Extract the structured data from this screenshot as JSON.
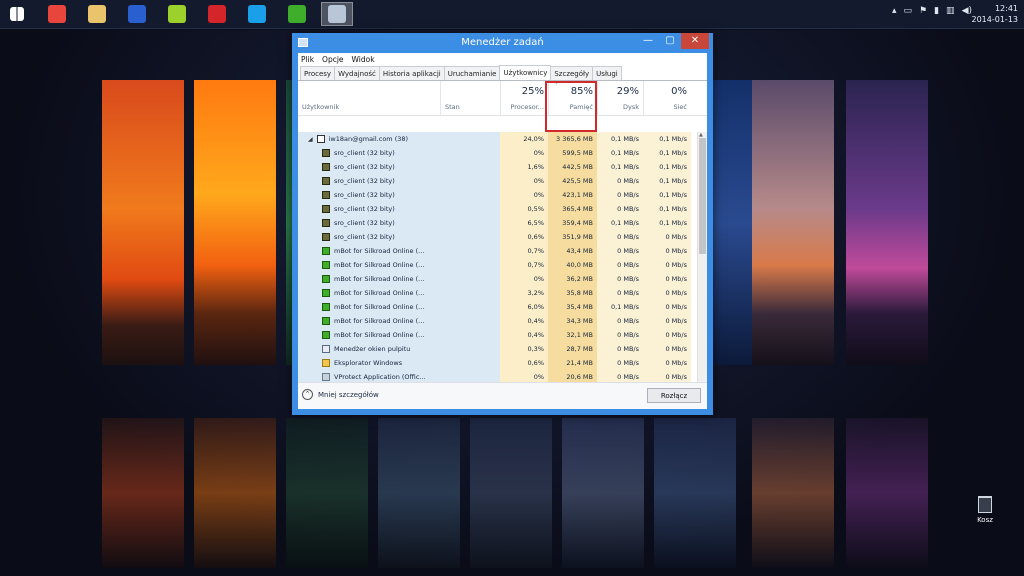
{
  "taskbar": {
    "apps": [
      {
        "name": "start-button",
        "icon": "windows-logo-icon",
        "color": "#ffffff",
        "active": false
      },
      {
        "name": "chrome",
        "icon": "chrome-icon",
        "color": "#e8453c",
        "active": false
      },
      {
        "name": "file-explorer",
        "icon": "folder-icon",
        "color": "#e9c46a",
        "active": false
      },
      {
        "name": "silkroad",
        "icon": "crown-icon",
        "color": "#2a5fd0",
        "active": false
      },
      {
        "name": "app-green-yellow",
        "icon": "battery-icon",
        "color": "#9bd12a",
        "active": false
      },
      {
        "name": "flash",
        "icon": "flash-icon",
        "color": "#d4262a",
        "active": false
      },
      {
        "name": "skype",
        "icon": "skype-icon",
        "color": "#1aa0e8",
        "active": false
      },
      {
        "name": "mbot",
        "icon": "mbot-icon",
        "color": "#3fae2a",
        "active": false
      },
      {
        "name": "task-manager",
        "icon": "task-manager-icon",
        "color": "#b8c6d8",
        "active": true
      }
    ],
    "clock": {
      "time": "12:41",
      "date": "2014-01-13"
    }
  },
  "desktop": {
    "recycle_bin_label": "Kosz"
  },
  "window": {
    "title": "Menedżer zadań",
    "menu": [
      "Plik",
      "Opcje",
      "Widok"
    ],
    "tabs": [
      "Procesy",
      "Wydajność",
      "Historia aplikacji",
      "Uruchamianie",
      "Użytkownicy",
      "Szczegóły",
      "Usługi"
    ],
    "selected_tab": "Użytkownicy",
    "columns": {
      "user": "Użytkownik",
      "status": "Stan",
      "cpu": {
        "percent": "25%",
        "label": "Procesor..."
      },
      "memory": {
        "percent": "85%",
        "label": "Pamięć"
      },
      "disk": {
        "percent": "29%",
        "label": "Dysk"
      },
      "network": {
        "percent": "0%",
        "label": "Sieć"
      }
    },
    "rows": [
      {
        "name": "iw18an@gmail.com (38)",
        "icon": "user-icon",
        "kind": "user",
        "cpu": "24,0%",
        "mem": "3 365,6 MB",
        "disk": "0,1 MB/s",
        "net": "0,1 Mb/s"
      },
      {
        "name": "sro_client (32 bity)",
        "icon": "sro-icon",
        "kind": "proc",
        "cpu": "0%",
        "mem": "599,5 MB",
        "disk": "0,1 MB/s",
        "net": "0,1 Mb/s"
      },
      {
        "name": "sro_client (32 bity)",
        "icon": "sro-icon",
        "kind": "proc",
        "cpu": "1,6%",
        "mem": "442,5 MB",
        "disk": "0,1 MB/s",
        "net": "0,1 Mb/s"
      },
      {
        "name": "sro_client (32 bity)",
        "icon": "sro-icon",
        "kind": "proc",
        "cpu": "0%",
        "mem": "425,5 MB",
        "disk": "0 MB/s",
        "net": "0,1 Mb/s"
      },
      {
        "name": "sro_client (32 bity)",
        "icon": "sro-icon",
        "kind": "proc",
        "cpu": "0%",
        "mem": "423,1 MB",
        "disk": "0 MB/s",
        "net": "0,1 Mb/s"
      },
      {
        "name": "sro_client (32 bity)",
        "icon": "sro-icon",
        "kind": "proc",
        "cpu": "0,5%",
        "mem": "365,4 MB",
        "disk": "0 MB/s",
        "net": "0,1 Mb/s"
      },
      {
        "name": "sro_client (32 bity)",
        "icon": "sro-icon",
        "kind": "proc",
        "cpu": "6,5%",
        "mem": "359,4 MB",
        "disk": "0,1 MB/s",
        "net": "0,1 Mb/s"
      },
      {
        "name": "sro_client (32 bity)",
        "icon": "sro-icon",
        "kind": "proc",
        "cpu": "0,6%",
        "mem": "351,9 MB",
        "disk": "0 MB/s",
        "net": "0 Mb/s"
      },
      {
        "name": "mBot for Silkroad Online (...",
        "icon": "mbot-icon",
        "kind": "proc",
        "cpu": "0,7%",
        "mem": "43,4 MB",
        "disk": "0 MB/s",
        "net": "0 Mb/s"
      },
      {
        "name": "mBot for Silkroad Online (...",
        "icon": "mbot-icon",
        "kind": "proc",
        "cpu": "0,7%",
        "mem": "40,0 MB",
        "disk": "0 MB/s",
        "net": "0 Mb/s"
      },
      {
        "name": "mBot for Silkroad Online (...",
        "icon": "mbot-icon",
        "kind": "proc",
        "cpu": "0%",
        "mem": "36,2 MB",
        "disk": "0 MB/s",
        "net": "0 Mb/s"
      },
      {
        "name": "mBot for Silkroad Online (...",
        "icon": "mbot-icon",
        "kind": "proc",
        "cpu": "3,2%",
        "mem": "35,8 MB",
        "disk": "0 MB/s",
        "net": "0 Mb/s"
      },
      {
        "name": "mBot for Silkroad Online (...",
        "icon": "mbot-icon",
        "kind": "proc",
        "cpu": "6,0%",
        "mem": "35,4 MB",
        "disk": "0,1 MB/s",
        "net": "0 Mb/s"
      },
      {
        "name": "mBot for Silkroad Online (...",
        "icon": "mbot-icon",
        "kind": "proc",
        "cpu": "0,4%",
        "mem": "34,3 MB",
        "disk": "0 MB/s",
        "net": "0 Mb/s"
      },
      {
        "name": "mBot for Silkroad Online (...",
        "icon": "mbot-icon",
        "kind": "proc",
        "cpu": "0,4%",
        "mem": "32,1 MB",
        "disk": "0 MB/s",
        "net": "0 Mb/s"
      },
      {
        "name": "Menedżer okien pulpitu",
        "icon": "dwm-icon",
        "kind": "proc",
        "cpu": "0,3%",
        "mem": "28,7 MB",
        "disk": "0 MB/s",
        "net": "0 Mb/s"
      },
      {
        "name": "Eksplorator Windows",
        "icon": "explorer-icon",
        "kind": "proc",
        "cpu": "0,6%",
        "mem": "21,4 MB",
        "disk": "0 MB/s",
        "net": "0 Mb/s"
      },
      {
        "name": "VProtect Application (Offic...",
        "icon": "vprotect-icon",
        "kind": "proc",
        "cpu": "0%",
        "mem": "20,6 MB",
        "disk": "0 MB/s",
        "net": "0 Mb/s"
      }
    ],
    "footer": {
      "less_details": "Mniej szczegółów",
      "end_task": "Rozłącz"
    }
  }
}
